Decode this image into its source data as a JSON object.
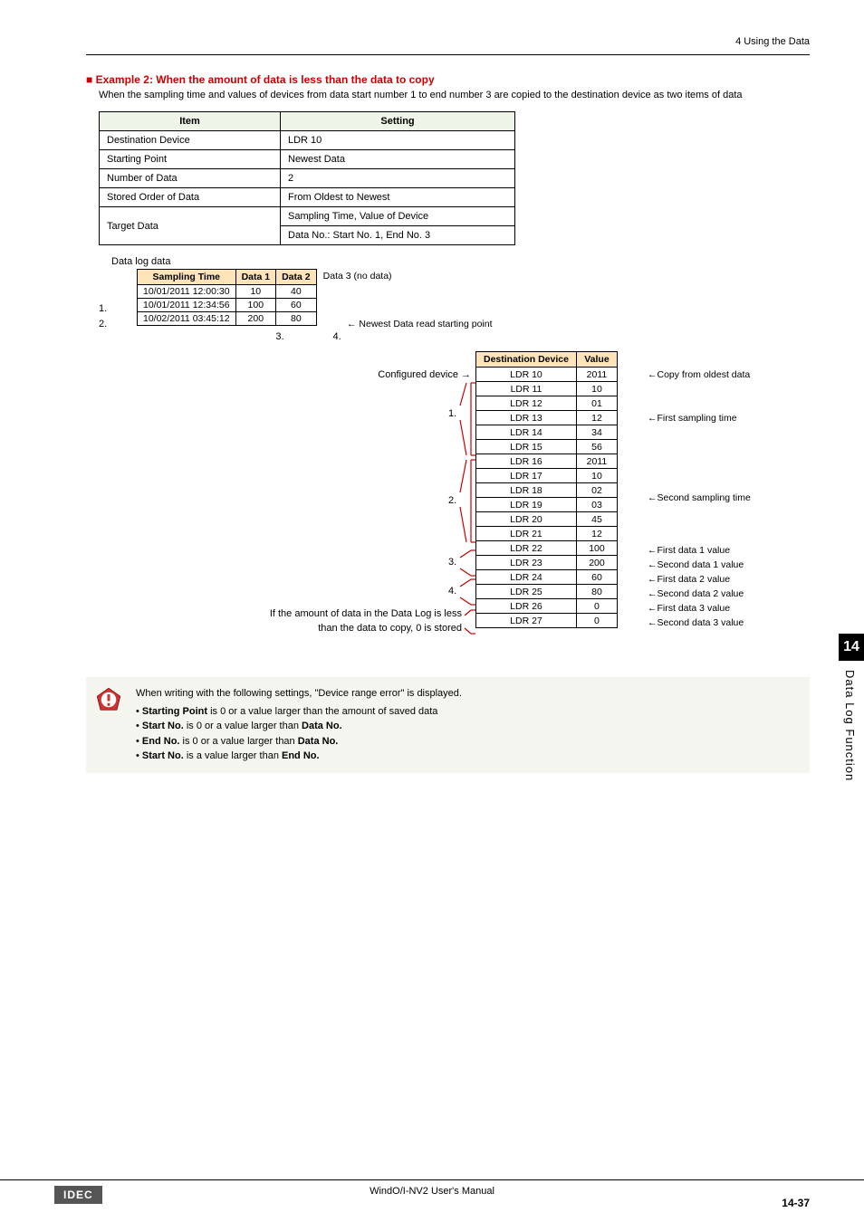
{
  "header": {
    "section": "4 Using the Data"
  },
  "example": {
    "title": "■ Example 2: When the amount of data is less than the data to copy",
    "desc": "When the sampling time and values of devices from data start number 1 to end number 3 are copied to the destination device as two items of data"
  },
  "settings": {
    "headers": {
      "item": "Item",
      "setting": "Setting"
    },
    "rows": [
      {
        "item": "Destination Device",
        "setting": "LDR 10"
      },
      {
        "item": "Starting Point",
        "setting": "Newest Data"
      },
      {
        "item": "Number of Data",
        "setting": "2"
      },
      {
        "item": "Stored Order of Data",
        "setting": "From Oldest to Newest"
      }
    ],
    "target_label": "Target Data",
    "target_rows": [
      "Sampling Time, Value of Device",
      "Data No.: Start No. 1, End No. 3"
    ]
  },
  "log": {
    "caption": "Data log data",
    "headers": {
      "time": "Sampling Time",
      "d1": "Data 1",
      "d2": "Data 2"
    },
    "after_header": "Data 3 (no data)",
    "rows": [
      {
        "time": "10/01/2011 12:00:30",
        "d1": "10",
        "d2": "40"
      },
      {
        "time": "10/01/2011 12:34:56",
        "d1": "100",
        "d2": "60"
      },
      {
        "time": "10/02/2011 03:45:12",
        "d1": "200",
        "d2": "80"
      }
    ],
    "row_label_1": "1.",
    "row_label_2": "2.",
    "col_label_3": "3.",
    "col_label_4": "4.",
    "newest_note": "← Newest Data read starting point"
  },
  "dest": {
    "headers": {
      "dev": "Destination Device",
      "val": "Value"
    },
    "configured_label": "Configured device →",
    "group1_label": "1.",
    "group2_label": "2.",
    "group3_label": "3.",
    "group4_label": "4.",
    "less_label_1": "If the amount of data in the Data Log is less",
    "less_label_2": "than the data to copy, 0 is stored",
    "rows": [
      {
        "dev": "LDR 10",
        "val": "2011",
        "note": "←Copy from oldest data"
      },
      {
        "dev": "LDR 11",
        "val": "10",
        "note": ""
      },
      {
        "dev": "LDR 12",
        "val": "01",
        "note": ""
      },
      {
        "dev": "LDR 13",
        "val": "12",
        "note": "←First sampling time"
      },
      {
        "dev": "LDR 14",
        "val": "34",
        "note": ""
      },
      {
        "dev": "LDR 15",
        "val": "56",
        "note": ""
      },
      {
        "dev": "LDR 16",
        "val": "2011",
        "note": ""
      },
      {
        "dev": "LDR 17",
        "val": "10",
        "note": ""
      },
      {
        "dev": "LDR 18",
        "val": "02",
        "note": "←Second sampling time"
      },
      {
        "dev": "LDR 19",
        "val": "03",
        "note": ""
      },
      {
        "dev": "LDR 20",
        "val": "45",
        "note": ""
      },
      {
        "dev": "LDR 21",
        "val": "12",
        "note": ""
      },
      {
        "dev": "LDR 22",
        "val": "100",
        "note": "←First data 1 value"
      },
      {
        "dev": "LDR 23",
        "val": "200",
        "note": "←Second data 1 value"
      },
      {
        "dev": "LDR 24",
        "val": "60",
        "note": "←First data 2 value"
      },
      {
        "dev": "LDR 25",
        "val": "80",
        "note": "←Second data 2 value"
      },
      {
        "dev": "LDR 26",
        "val": "0",
        "note": "←First data 3 value"
      },
      {
        "dev": "LDR 27",
        "val": "0",
        "note": "←Second data 3 value"
      }
    ]
  },
  "warning": {
    "lead": "When writing with the following settings, \"Device range error\" is displayed.",
    "b1a": "Starting Point",
    "b1b": " is 0 or a value larger than the amount of saved data",
    "b2a": "Start No.",
    "b2b": " is 0 or a value larger than ",
    "b2c": "Data No.",
    "b3a": "End No.",
    "b3b": " is 0 or a value larger than ",
    "b3c": "Data No.",
    "b4a": "Start No.",
    "b4b": " is a value larger than ",
    "b4c": "End No."
  },
  "sidetab": {
    "num": "14",
    "text": "Data Log Function"
  },
  "footer": {
    "logo": "IDEC",
    "center": "WindO/I-NV2 User's Manual",
    "page": "14-37"
  }
}
